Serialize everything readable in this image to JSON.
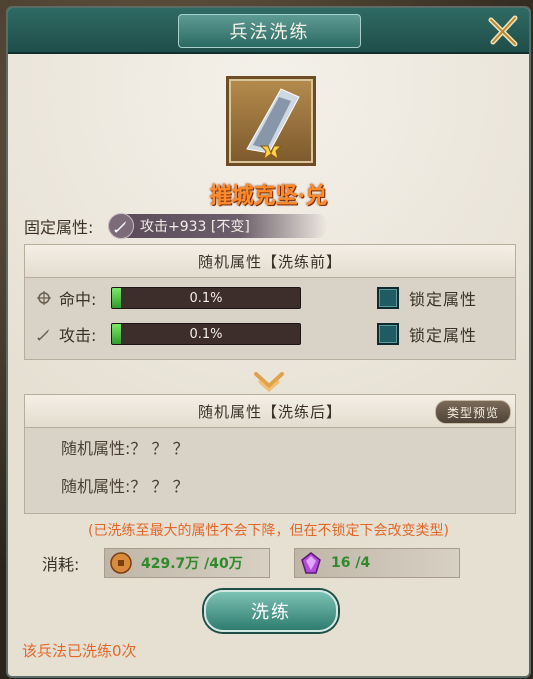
{
  "dialog": {
    "title": "兵法洗练",
    "item_name": "摧城克坚·兑",
    "fixed": {
      "label": "固定属性:",
      "value": "攻击+933 [不变]"
    },
    "before_panel": {
      "header": "随机属性【洗练前】",
      "rows": [
        {
          "label": "命中:",
          "value": "0.1%",
          "fill_percent": 5,
          "lock_label": "锁定属性",
          "icon": "target-icon"
        },
        {
          "label": "攻击:",
          "value": "0.1%",
          "fill_percent": 5,
          "lock_label": "锁定属性",
          "icon": "sword-icon"
        }
      ]
    },
    "after_panel": {
      "header": "随机属性【洗练后】",
      "preview_button": "类型预览",
      "rows": [
        "随机属性:？ ？ ？",
        "随机属性:？ ？ ？"
      ]
    },
    "note": "(已洗练至最大的属性不会下降，但在不锁定下会改变类型)",
    "cost": {
      "label": "消耗:",
      "coins": {
        "value": "429.7万 /40万",
        "icon": "coin-icon"
      },
      "gems": {
        "value": "16 /4",
        "icon": "crystal-icon"
      }
    },
    "wash_button": "洗练",
    "status": "该兵法已洗练0次",
    "colors": {
      "accent": "#2f6a64",
      "warning": "#e2682a",
      "value_green": "#2f8a2b"
    }
  }
}
